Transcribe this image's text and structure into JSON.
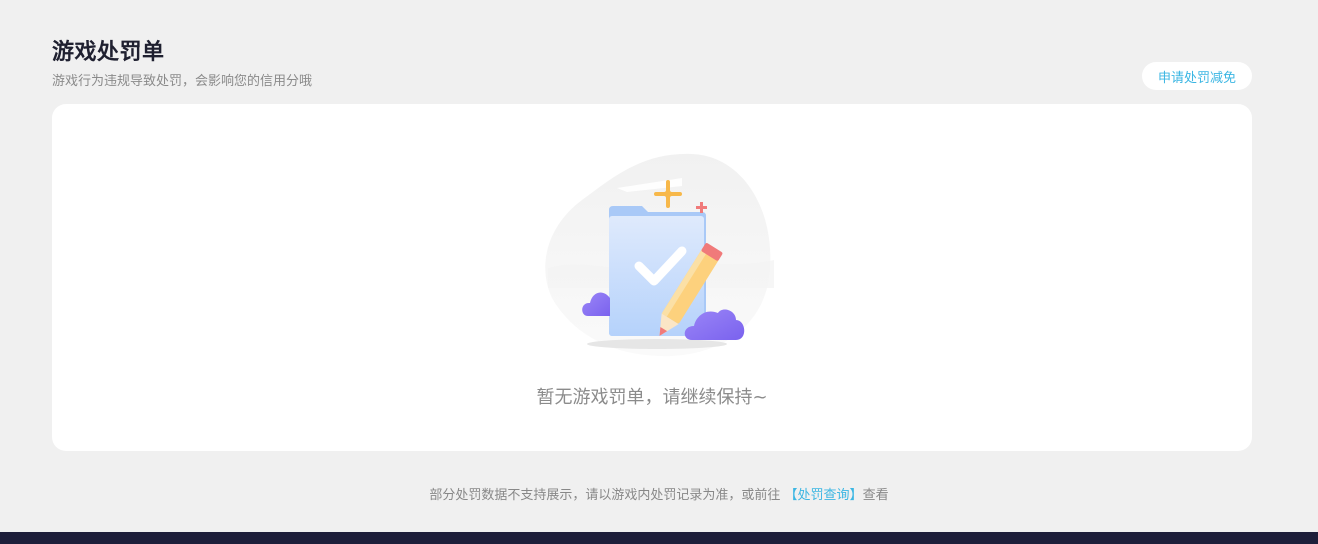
{
  "header": {
    "title": "游戏处罚单",
    "subtitle": "游戏行为违规导致处罚，会影响您的信用分哦",
    "appeal_button": "申请处罚减免"
  },
  "empty_state": {
    "message": "暂无游戏罚单，请继续保持~",
    "illustration_icon": "folder-checkmark-pencil-icon"
  },
  "footer": {
    "note_prefix": "部分处罚数据不支持展示，请以游戏内处罚记录为准，或前往 ",
    "link_text": "【处罚查询】",
    "note_suffix": "查看"
  },
  "colors": {
    "background": "#f0f0f0",
    "card": "#ffffff",
    "accent": "#3bb6e3",
    "title": "#1f2030",
    "bottom_bar": "#1d1e3a"
  }
}
